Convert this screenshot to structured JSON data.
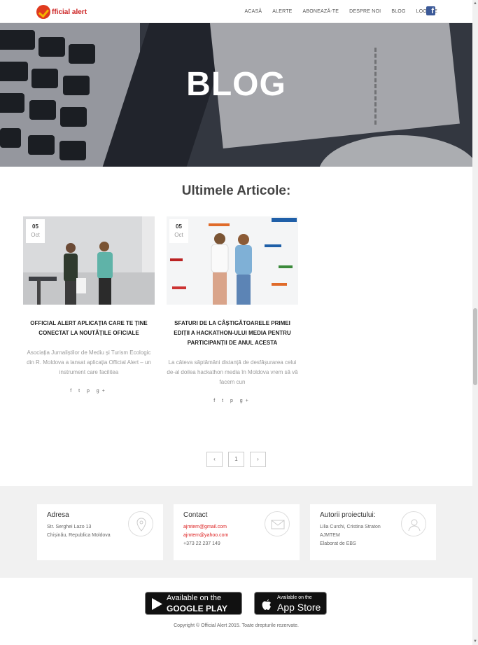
{
  "header": {
    "logo_text": "fficial alert",
    "nav": [
      "ACASĂ",
      "ALERTE",
      "ABONEAZĂ-TE",
      "DESPRE NOI",
      "BLOG",
      "LOGARE"
    ],
    "facebook_glyph": "f"
  },
  "hero": {
    "title": "BLOG"
  },
  "section": {
    "title": "Ultimele Articole:"
  },
  "articles": [
    {
      "day": "05",
      "month": "Oct",
      "title": "OFFICIAL ALERT APLICAȚIA CARE TE ȚINE CONECTAT LA NOUTĂȚILE OFICIALE",
      "excerpt": "Asociația Jurnaliștilor de Mediu și Turism Ecologic din R. Moldova a lansat aplicația Official Alert – un instrument care facilitea",
      "share": "f  t  p  g+"
    },
    {
      "day": "05",
      "month": "Oct",
      "title": "SFATURI DE LA CÂȘTIGĂTOARELE PRIMEI EDIȚII A HACKATHON-ULUI MEDIA PENTRU PARTICIPANȚII DE ANUL ACESTA",
      "excerpt": "La câteva săptămâni distanță de desfășurarea celui de-al doilea hackathon media în Moldova vrem să vă facem cun",
      "share": "f  t  p  g+"
    }
  ],
  "pagination": {
    "prev": "‹",
    "current": "1",
    "next": "›"
  },
  "footer": {
    "address": {
      "title": "Adresa",
      "lines": [
        "Str. Serghei Lazo 13",
        "Chișinău, Republica Moldova"
      ],
      "icon": "location-pin-icon"
    },
    "contact": {
      "title": "Contact",
      "email1": "ajmtem@gmail.com",
      "email2": "ajmtem@yahoo.com",
      "phone": "+373 22 237 149",
      "icon": "envelope-icon"
    },
    "authors": {
      "title": "Autorii proiectului:",
      "lines": [
        "Lilia Curchi, Cristina Straton",
        "AJMTEM",
        "Elaborat de EBS"
      ],
      "icon": "user-icon"
    }
  },
  "stores": {
    "google": {
      "small": "Available on the",
      "big": "GOOGLE PLAY"
    },
    "apple": {
      "small": "Available on the",
      "big": "App Store"
    }
  },
  "copyright": "Copyright © Official Alert 2015. Toate drepturile rezervate."
}
